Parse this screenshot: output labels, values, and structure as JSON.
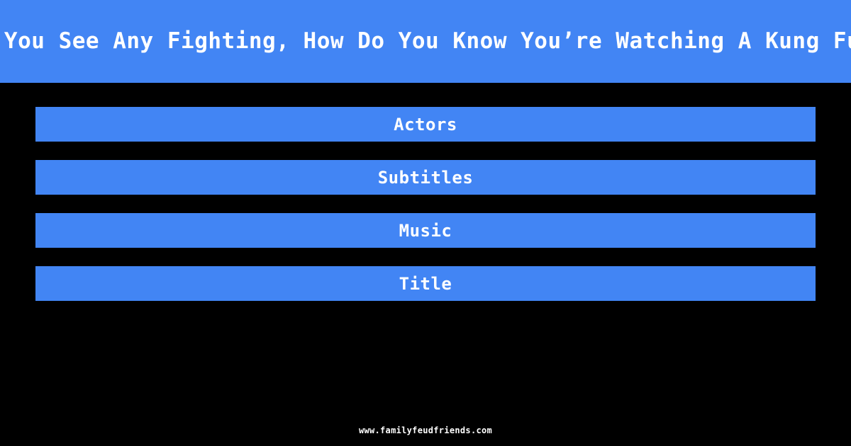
{
  "theme": {
    "background_color": "#000000",
    "accent_color": "#4285f4",
    "text_color": "#ffffff"
  },
  "header": {
    "question": "Before You See Any Fighting, How Do You Know You’re Watching A Kung Fu Movie"
  },
  "answers": {
    "items": [
      {
        "label": "Actors"
      },
      {
        "label": "Subtitles"
      },
      {
        "label": "Music"
      },
      {
        "label": "Title"
      }
    ]
  },
  "footer": {
    "url": "www.familyfeudfriends.com"
  }
}
